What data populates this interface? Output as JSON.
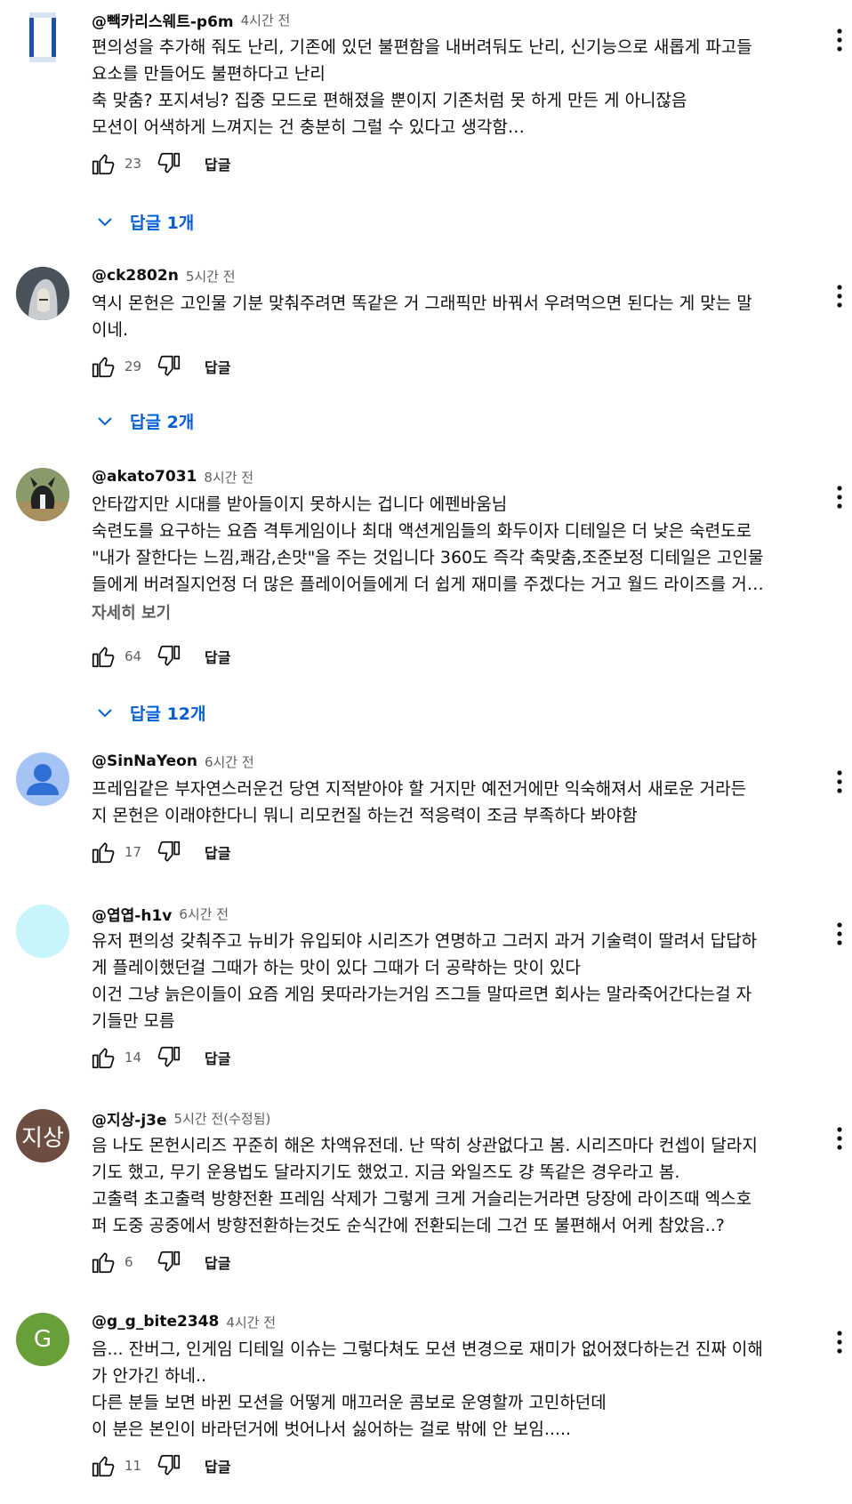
{
  "colors": {
    "link": "#065fd4",
    "meta": "#606060",
    "text": "#0f0f0f"
  },
  "labels": {
    "reply": "답글"
  },
  "comments": [
    {
      "author": "@빽카리스웨트-p6m",
      "time": "4시간 전",
      "avatar": {
        "type": "can-image",
        "text": "POCARI SWEAT"
      },
      "lines": [
        "편의성을 추가해 줘도 난리, 기존에 있던 불편함을 내버려둬도 난리, 신기능으로 새롭게 파고들",
        "요소를 만들어도 불편하다고 난리",
        "축 맞춤? 포지셔닝? 집중 모드로 편해졌을 뿐이지 기존처럼 못 하게 만든 게 아니잖음",
        "모션이 어색하게 느껴지는 건 충분히 그럴 수 있다고 생각함…"
      ],
      "likes": "23",
      "replies": "답글 1개"
    },
    {
      "author": "@ck2802n",
      "time": "5시간 전",
      "avatar": {
        "type": "character-image"
      },
      "lines": [
        "역시 몬헌은 고인물 기분 맞춰주려면 똑같은 거 그래픽만 바꿔서 우려먹으면 된다는 게 맞는 말",
        "이네."
      ],
      "likes": "29",
      "replies": "답글 2개"
    },
    {
      "author": "@akato7031",
      "time": "8시간 전",
      "avatar": {
        "type": "dog-image"
      },
      "lines": [
        "안타깝지만 시대를 받아들이지 못하시는 겁니다 에펜바움님",
        "숙련도를 요구하는 요즘 격투게임이나 최대 액션게임들의 화두이자 디테일은 더 낮은 숙련도로",
        "\"내가 잘한다는 느낌,쾌감,손맛\"을 주는 것입니다 360도 즉각 축맞춤,조준보정 디테일은 고인물",
        "들에게 버려질지언정 더 많은 플레이어들에게 더 쉽게 재미를 주겠다는 거고 월드 라이즈를 거…"
      ],
      "more": "자세히 보기",
      "likes": "64",
      "replies": "답글 12개"
    },
    {
      "author": "@SinNaYeon",
      "time": "6시간 전",
      "avatar": {
        "type": "default-person",
        "color": "#a5c3f5"
      },
      "lines": [
        "프레임같은 부자연스러운건 당연 지적받아야 할 거지만 예전거에만 익숙해져서 새로운 거라든",
        "지 몬헌은 이래야한다니 뭐니 리모컨질 하는건 적응력이 조금 부족하다 봐야함"
      ],
      "likes": "17"
    },
    {
      "author": "@엽엽-h1v",
      "time": "6시간 전",
      "avatar": {
        "type": "solid",
        "color": "#c8f5fb"
      },
      "lines": [
        "유저 편의성 갖춰주고 뉴비가 유입되야 시리즈가 연명하고 그러지 과거 기술력이 딸려서 답답하",
        "게 플레이했던걸 그때가 하는 맛이 있다 그때가 더 공략하는 맛이 있다",
        "이건 그냥 늙은이들이 요즘 게임 못따라가는거임 즈그들 말따르면 회사는 말라죽어간다는걸 자",
        "기들만 모름"
      ],
      "likes": "14"
    },
    {
      "author": "@지상-j3e",
      "time": "5시간 전(수정됨)",
      "avatar": {
        "type": "letter",
        "text": "지상",
        "color": "#6d4c41"
      },
      "lines": [
        "음 나도 몬헌시리즈 꾸준히 해온 차액유전데. 난 딱히 상관없다고 봄. 시리즈마다 컨셉이 달라지",
        "기도 했고, 무기 운용법도 달라지기도 했었고. 지금 와일즈도 걍 똑같은 경우라고 봄.",
        "고출력 초고출력 방향전환 프레임 삭제가 그렇게 크게 거슬리는거라면 당장에 라이즈때 엑스호",
        "퍼  도중 공중에서 방향전환하는것도 순식간에 전환되는데 그건 또 불편해서 어케 참았음..?"
      ],
      "likes": "6"
    },
    {
      "author": "@g_g_bite2348",
      "time": "4시간 전",
      "avatar": {
        "type": "letter",
        "text": "G",
        "color": "#689f38"
      },
      "lines": [
        "음... 잔버그, 인게임 디테일 이슈는 그렇다쳐도 모션 변경으로 재미가 없어졌다하는건 진짜 이해",
        "가 안가긴 하네..",
        "다른 분들 보면 바뀐 모션을 어떻게 매끄러운 콤보로 운영할까 고민하던데",
        "이 분은 본인이 바라던거에 벗어나서 싫어하는 걸로 밖에 안 보임....."
      ],
      "likes": "11"
    }
  ]
}
